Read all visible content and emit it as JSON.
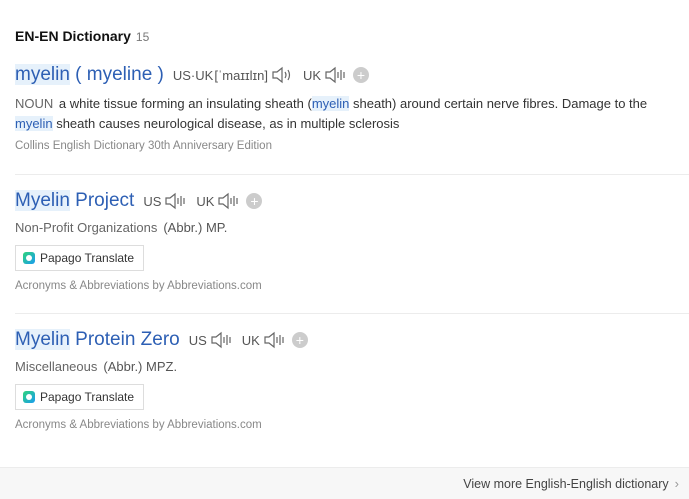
{
  "header": {
    "title": "EN-EN Dictionary",
    "count": "15"
  },
  "entries": [
    {
      "word_hl": "myelin",
      "word_rest": " ( myeline )",
      "us_label": "US·UK",
      "phonetic": "[ˈmaɪɪlɪn]",
      "uk_label": "UK",
      "pos": "NOUN",
      "def_1": " a white tissue forming an insulating sheath (",
      "def_hl_1": "myelin",
      "def_2": " sheath) around certain nerve fibres. Damage to the ",
      "def_hl_2": "myelin",
      "def_3": " sheath causes neurological disease, as in multiple sclerosis",
      "source": "Collins English Dictionary 30th Anniversary Edition"
    },
    {
      "word_hl": "Myelin",
      "word_rest": " Project",
      "us_label": "US",
      "uk_label": "UK",
      "category": "Non-Profit Organizations",
      "abbr": "(Abbr.) MP.",
      "translate_label": "Papago Translate",
      "source": "Acronyms & Abbreviations by Abbreviations.com"
    },
    {
      "word_hl": "Myelin",
      "word_rest": " Protein Zero",
      "us_label": "US",
      "uk_label": "UK",
      "category": "Miscellaneous",
      "abbr": "(Abbr.) MPZ.",
      "translate_label": "Papago Translate",
      "source": "Acronyms & Abbreviations by Abbreviations.com"
    }
  ],
  "plus_symbol": "+",
  "footer": {
    "more_label": "View more English-English dictionary",
    "chevron": "›"
  },
  "icons": {
    "speaker": "speaker-icon",
    "add": "add-icon",
    "papago": "papago-logo-icon"
  },
  "colors": {
    "link": "#2d5fb4",
    "highlight": "#e6f1fb"
  }
}
